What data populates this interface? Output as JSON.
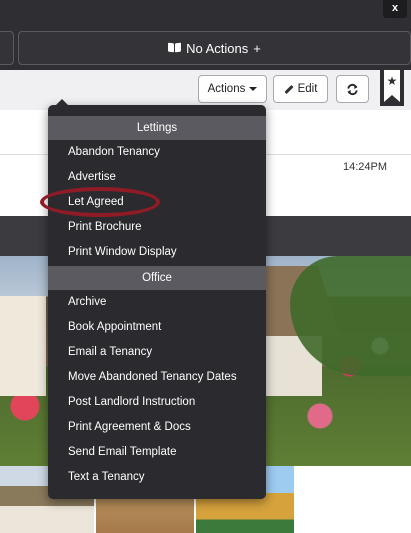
{
  "window": {
    "close_label": "x"
  },
  "header": {
    "no_actions_label": "No Actions",
    "add_label": "+"
  },
  "toolbar": {
    "actions_label": "Actions",
    "edit_label": "Edit"
  },
  "card": {
    "time": "14:24PM"
  },
  "dropdown": {
    "sections": [
      {
        "title": "Lettings",
        "items": [
          "Abandon Tenancy",
          "Advertise",
          "Let Agreed",
          "Print Brochure",
          "Print Window Display"
        ]
      },
      {
        "title": "Office",
        "items": [
          "Archive",
          "Book Appointment",
          "Email a Tenancy",
          "Move Abandoned Tenancy Dates",
          "Post Landlord Instruction",
          "Print Agreement & Docs",
          "Send Email Template",
          "Text a Tenancy"
        ]
      }
    ],
    "highlighted_item": "Let Agreed",
    "highlight_color": "#8e1b26"
  },
  "icons": [
    "book-icon",
    "caret-down-icon",
    "pencil-icon",
    "refresh-icon",
    "bookmark-star-icon"
  ]
}
